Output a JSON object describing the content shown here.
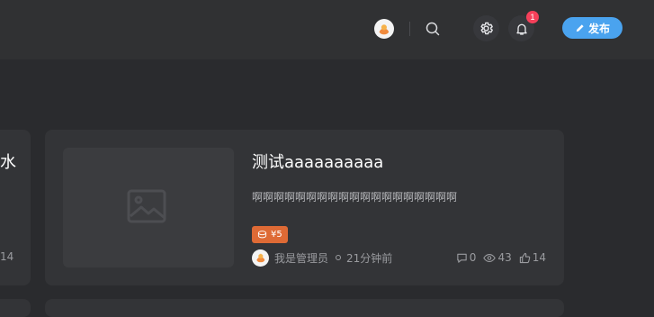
{
  "header": {
    "publish_label": "发布",
    "notification_count": "1",
    "icons": [
      "user-avatar",
      "search-icon",
      "settings-icon",
      "bell-icon",
      "pen-icon"
    ]
  },
  "left_card": {
    "title_fragment": "水",
    "count_fragment": "14"
  },
  "post": {
    "title": "测试aaaaaaaaaa",
    "excerpt": "啊啊啊啊啊啊啊啊啊啊啊啊啊啊啊啊啊啊啊",
    "price": "¥5",
    "author": "我是管理员",
    "time": "21分钟前",
    "comments": "0",
    "views": "43",
    "likes": "14"
  },
  "colors": {
    "background": "#2a2b2e",
    "topbar": "#303133",
    "card": "#333437",
    "accent": "#4aa3ef",
    "price_tag": "#de6a35",
    "badge": "#f5405a"
  }
}
